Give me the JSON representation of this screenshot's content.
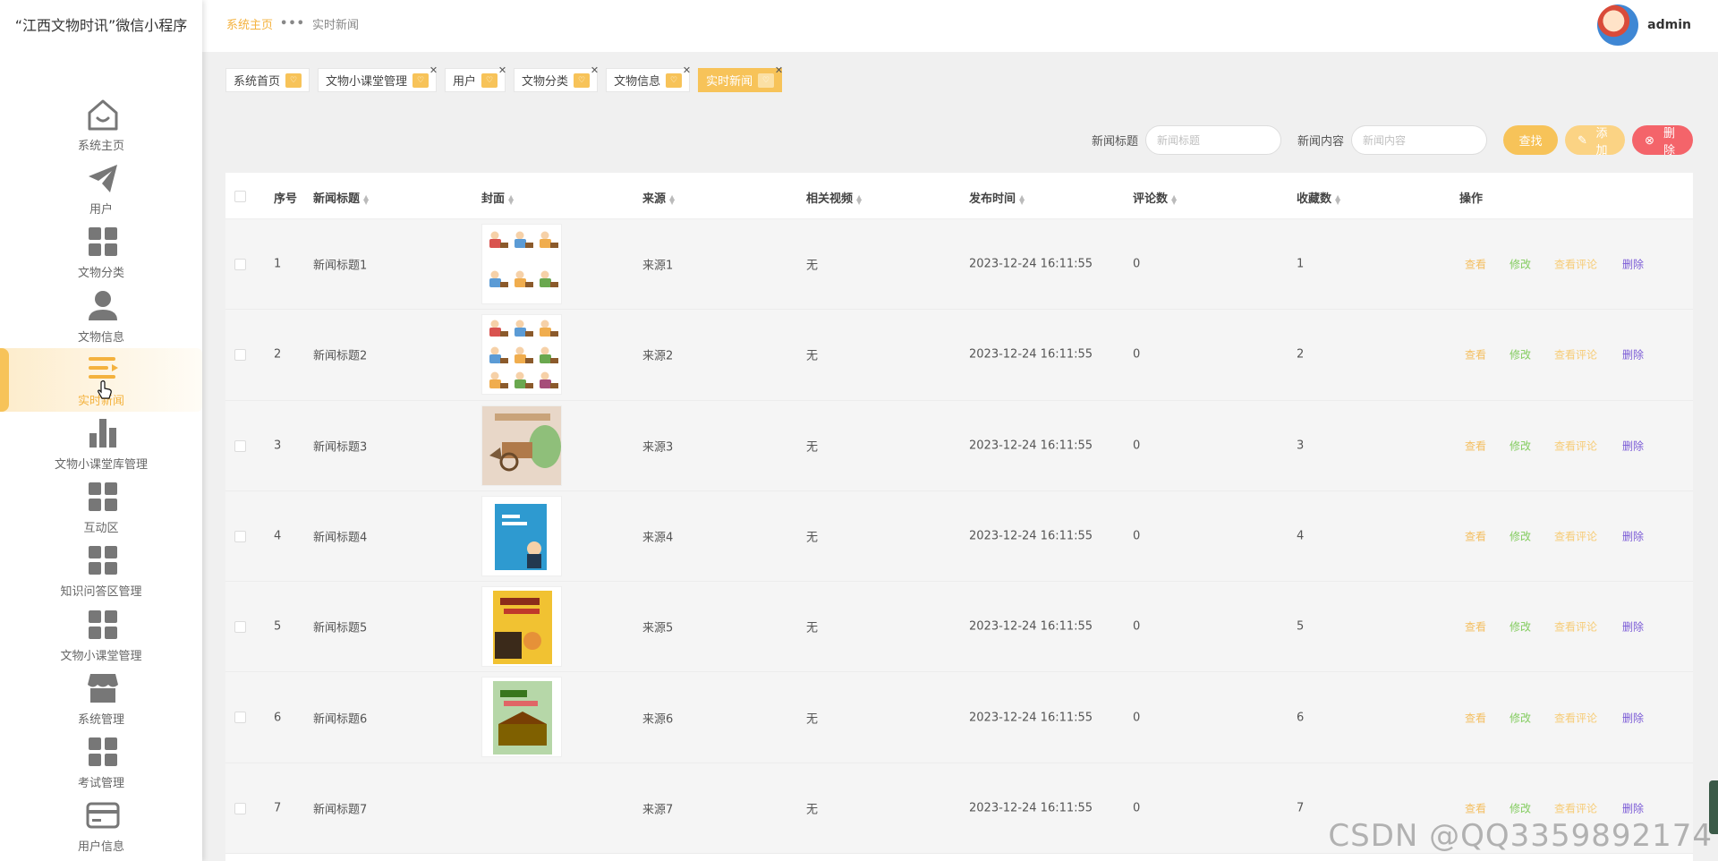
{
  "app": {
    "title": "“江西文物时讯”微信小程序"
  },
  "sidebar": {
    "items": [
      {
        "label": "系统主页",
        "icon": "house-icon"
      },
      {
        "label": "用户",
        "icon": "paper-plane-icon"
      },
      {
        "label": "文物分类",
        "icon": "grid-icon"
      },
      {
        "label": "文物信息",
        "icon": "person-icon"
      },
      {
        "label": "实时新闻",
        "icon": "list-icon",
        "active": true
      },
      {
        "label": "文物小课堂库管理",
        "icon": "bar-chart-icon"
      },
      {
        "label": "互动区",
        "icon": "grid-icon"
      },
      {
        "label": "知识问答区管理",
        "icon": "grid-icon"
      },
      {
        "label": "文物小课堂管理",
        "icon": "grid-icon"
      },
      {
        "label": "系统管理",
        "icon": "store-icon"
      },
      {
        "label": "考试管理",
        "icon": "grid-icon"
      },
      {
        "label": "用户信息",
        "icon": "card-icon"
      }
    ]
  },
  "header": {
    "breadcrumb": {
      "home": "系统主页",
      "current": "实时新闻"
    },
    "user": {
      "name": "admin"
    }
  },
  "tags": [
    {
      "label": "系统首页",
      "closable": false
    },
    {
      "label": "文物小课堂管理",
      "closable": true
    },
    {
      "label": "用户",
      "closable": true
    },
    {
      "label": "文物分类",
      "closable": true
    },
    {
      "label": "文物信息",
      "closable": true
    },
    {
      "label": "实时新闻",
      "closable": true,
      "active": true
    }
  ],
  "search": {
    "title_label": "新闻标题",
    "title_placeholder": "新闻标题",
    "content_label": "新闻内容",
    "content_placeholder": "新闻内容",
    "find": "查找",
    "add": "添加",
    "delete": "删除"
  },
  "table": {
    "columns": [
      "序号",
      "新闻标题",
      "封面",
      "来源",
      "相关视频",
      "发布时间",
      "评论数",
      "收藏数",
      "操作"
    ],
    "actions": {
      "view": "查看",
      "edit": "修改",
      "comments": "查看评论",
      "delete": "删除"
    },
    "rows": [
      {
        "index": "1",
        "title": "新闻标题1",
        "source": "来源1",
        "video": "无",
        "time": "2023-12-24 16:11:55",
        "comments": "0",
        "favorites": "1",
        "cover": "cartoon-kids-1"
      },
      {
        "index": "2",
        "title": "新闻标题2",
        "source": "来源2",
        "video": "无",
        "time": "2023-12-24 16:11:55",
        "comments": "0",
        "favorites": "2",
        "cover": "cartoon-kids-2"
      },
      {
        "index": "3",
        "title": "新闻标题3",
        "source": "来源3",
        "video": "无",
        "time": "2023-12-24 16:11:55",
        "comments": "0",
        "favorites": "3",
        "cover": "book-cart"
      },
      {
        "index": "4",
        "title": "新闻标题4",
        "source": "来源4",
        "video": "无",
        "time": "2023-12-24 16:11:55",
        "comments": "0",
        "favorites": "4",
        "cover": "book-blue"
      },
      {
        "index": "5",
        "title": "新闻标题5",
        "source": "来源5",
        "video": "无",
        "time": "2023-12-24 16:11:55",
        "comments": "0",
        "favorites": "5",
        "cover": "book-yellow"
      },
      {
        "index": "6",
        "title": "新闻标题6",
        "source": "来源6",
        "video": "无",
        "time": "2023-12-24 16:11:55",
        "comments": "0",
        "favorites": "6",
        "cover": "book-green"
      },
      {
        "index": "7",
        "title": "新闻标题7",
        "source": "来源7",
        "video": "无",
        "time": "2023-12-24 16:11:55",
        "comments": "0",
        "favorites": "7",
        "cover": ""
      }
    ]
  },
  "watermark": "CSDN @QQ3359892174",
  "colors": {
    "accent": "#f7c359",
    "danger": "#f4646a",
    "edit": "#67c23a",
    "delete_link": "#7b5bd6"
  }
}
